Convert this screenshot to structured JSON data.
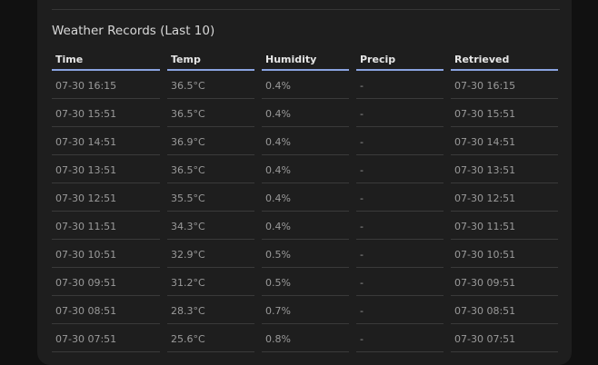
{
  "section": {
    "title": "Weather Records (Last 10)"
  },
  "table": {
    "columns": [
      "Time",
      "Temp",
      "Humidity",
      "Precip",
      "Retrieved"
    ],
    "rows": [
      [
        "07-30 16:15",
        "36.5°C",
        "0.4%",
        "-",
        "07-30 16:15"
      ],
      [
        "07-30 15:51",
        "36.5°C",
        "0.4%",
        "-",
        "07-30 15:51"
      ],
      [
        "07-30 14:51",
        "36.9°C",
        "0.4%",
        "-",
        "07-30 14:51"
      ],
      [
        "07-30 13:51",
        "36.5°C",
        "0.4%",
        "-",
        "07-30 13:51"
      ],
      [
        "07-30 12:51",
        "35.5°C",
        "0.4%",
        "-",
        "07-30 12:51"
      ],
      [
        "07-30 11:51",
        "34.3°C",
        "0.4%",
        "-",
        "07-30 11:51"
      ],
      [
        "07-30 10:51",
        "32.9°C",
        "0.5%",
        "-",
        "07-30 10:51"
      ],
      [
        "07-30 09:51",
        "31.2°C",
        "0.5%",
        "-",
        "07-30 09:51"
      ],
      [
        "07-30 08:51",
        "28.3°C",
        "0.7%",
        "-",
        "07-30 08:51"
      ],
      [
        "07-30 07:51",
        "25.6°C",
        "0.8%",
        "-",
        "07-30 07:51"
      ]
    ]
  },
  "colors": {
    "background": "#111111",
    "card": "#1e1e1e",
    "header_underline": "#8aa3e0",
    "row_divider": "#3a3a3a"
  }
}
